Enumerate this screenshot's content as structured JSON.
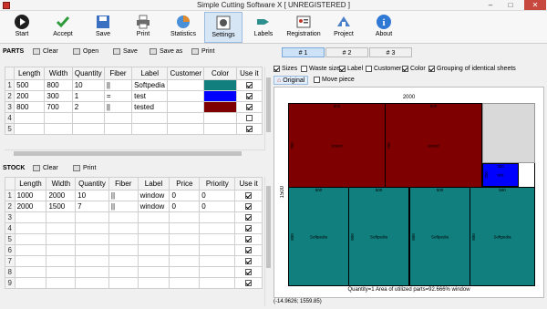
{
  "window": {
    "title": "Simple Cutting Software X [ UNREGISTERED ]",
    "minimize": "–",
    "maximize": "□",
    "close": "✕"
  },
  "ribbon": [
    {
      "label": "Start",
      "icon": "start-icon",
      "color": "#1f1f1f"
    },
    {
      "label": "Accept",
      "icon": "accept-icon",
      "color": "#2e9c3a"
    },
    {
      "label": "Save",
      "icon": "save-icon",
      "color": "#3a6fc1"
    },
    {
      "label": "Print",
      "icon": "print-icon",
      "color": "#6b6b6b"
    },
    {
      "label": "Statistics",
      "icon": "statistics-icon",
      "color": "#e08a2c"
    },
    {
      "label": "Settings",
      "icon": "settings-icon",
      "color": "#555555",
      "active": true
    },
    {
      "label": "Labels",
      "icon": "labels-icon",
      "color": "#2e8f8f"
    },
    {
      "label": "Registration",
      "icon": "registration-icon",
      "color": "#c0392b"
    },
    {
      "label": "Project",
      "icon": "project-icon",
      "color": "#4a7fc9"
    },
    {
      "label": "About",
      "icon": "about-icon",
      "color": "#2f78d3"
    }
  ],
  "parts": {
    "section_label": "PARTS",
    "toolbar": {
      "clear": "Clear",
      "open": "Open",
      "save": "Save",
      "save_as": "Save as",
      "print": "Print"
    },
    "columns": [
      "Length",
      "Width",
      "Quantity",
      "Fiber",
      "Label",
      "Customer",
      "Color",
      "Use it"
    ],
    "rows": [
      {
        "n": "1",
        "length": "500",
        "width": "800",
        "quantity": "10",
        "fiber": "||",
        "label": "Softpedia",
        "customer": "",
        "color": "#127f7f",
        "use": true
      },
      {
        "n": "2",
        "length": "200",
        "width": "300",
        "quantity": "1",
        "fiber": "=",
        "label": "test",
        "customer": "",
        "color": "#0000ff",
        "use": true
      },
      {
        "n": "3",
        "length": "800",
        "width": "700",
        "quantity": "2",
        "fiber": "||",
        "label": "tested",
        "customer": "",
        "color": "#7f0000",
        "use": true
      },
      {
        "n": "4",
        "length": "",
        "width": "",
        "quantity": "",
        "fiber": "",
        "label": "",
        "customer": "",
        "color": "",
        "use": false
      },
      {
        "n": "5",
        "length": "",
        "width": "",
        "quantity": "",
        "fiber": "",
        "label": "",
        "customer": "",
        "color": "",
        "use": true
      }
    ]
  },
  "stock": {
    "section_label": "STOCK",
    "toolbar": {
      "clear": "Clear",
      "print": "Print"
    },
    "columns": [
      "Length",
      "Width",
      "Quantity",
      "Fiber",
      "Label",
      "Price",
      "Priority",
      "Use it"
    ],
    "rows": [
      {
        "n": "1",
        "length": "1000",
        "width": "2000",
        "quantity": "10",
        "fiber": "||",
        "label": "window",
        "price": "0",
        "priority": "0",
        "use": true
      },
      {
        "n": "2",
        "length": "2000",
        "width": "1500",
        "quantity": "7",
        "fiber": "||",
        "label": "window",
        "price": "0",
        "priority": "0",
        "use": true
      },
      {
        "n": "3",
        "length": "",
        "width": "",
        "quantity": "",
        "fiber": "",
        "label": "",
        "price": "",
        "priority": "",
        "use": true
      },
      {
        "n": "4",
        "length": "",
        "width": "",
        "quantity": "",
        "fiber": "",
        "label": "",
        "price": "",
        "priority": "",
        "use": true
      },
      {
        "n": "5",
        "length": "",
        "width": "",
        "quantity": "",
        "fiber": "",
        "label": "",
        "price": "",
        "priority": "",
        "use": true
      },
      {
        "n": "6",
        "length": "",
        "width": "",
        "quantity": "",
        "fiber": "",
        "label": "",
        "price": "",
        "priority": "",
        "use": true
      },
      {
        "n": "7",
        "length": "",
        "width": "",
        "quantity": "",
        "fiber": "",
        "label": "",
        "price": "",
        "priority": "",
        "use": true
      },
      {
        "n": "8",
        "length": "",
        "width": "",
        "quantity": "",
        "fiber": "",
        "label": "",
        "price": "",
        "priority": "",
        "use": true
      },
      {
        "n": "9",
        "length": "",
        "width": "",
        "quantity": "",
        "fiber": "",
        "label": "",
        "price": "",
        "priority": "",
        "use": true
      }
    ]
  },
  "sheet_tabs": [
    "# 1",
    "# 2",
    "# 3"
  ],
  "options": {
    "sizes": {
      "label": "Sizes",
      "checked": true
    },
    "waste_size": {
      "label": "Waste size",
      "checked": false
    },
    "label": {
      "label": "Label",
      "checked": true
    },
    "customer": {
      "label": "Customer",
      "checked": false
    },
    "color": {
      "label": "Color",
      "checked": true
    },
    "grouping": {
      "label": "Grouping of identical sheets",
      "checked": true
    },
    "original": {
      "label": "Original"
    },
    "move_piece": {
      "label": "Move piece",
      "checked": false
    }
  },
  "layout_view": {
    "sheet_width": "2000",
    "sheet_height": "1500",
    "pieces": [
      {
        "label": "tested",
        "w": "800",
        "h": "700",
        "color": "#7f0000"
      },
      {
        "label": "tested",
        "w": "800",
        "h": "700",
        "color": "#7f0000"
      },
      {
        "label": "test",
        "w": "300",
        "h": "200",
        "color": "#0000ff"
      },
      {
        "label": "Softpedia",
        "w": "500",
        "h": "800",
        "color": "#127f7f"
      },
      {
        "label": "Softpedia",
        "w": "500",
        "h": "800",
        "color": "#127f7f"
      },
      {
        "label": "Softpedia",
        "w": "500",
        "h": "800",
        "color": "#127f7f"
      },
      {
        "label": "Softpedia",
        "w": "500",
        "h": "800",
        "color": "#127f7f"
      }
    ],
    "summary": "Quantity=1 Area of utilized parts=92.666%  window"
  },
  "status": "(-14.9626; 1559.85)"
}
